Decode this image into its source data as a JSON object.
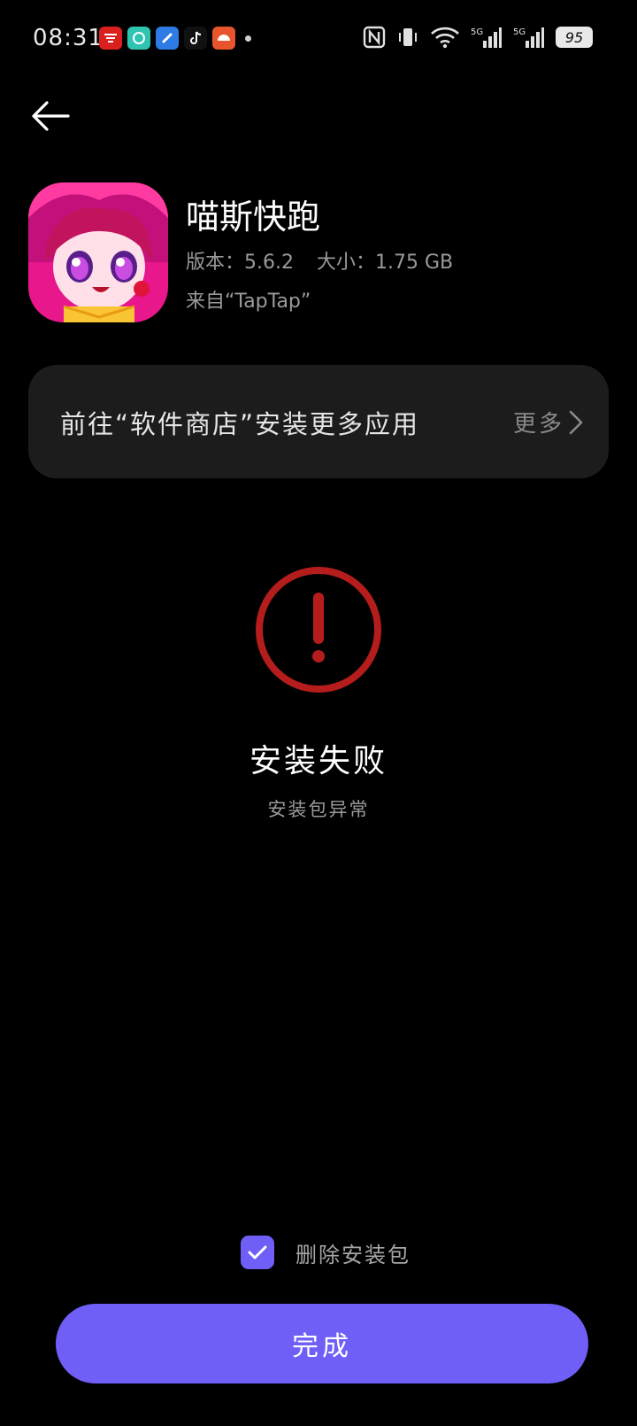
{
  "status_bar": {
    "time": "08:31",
    "notification_icons": [
      {
        "name": "xuexi-app-icon",
        "color": "#d9201e"
      },
      {
        "name": "chat-app-icon",
        "color": "#2fc4b2"
      },
      {
        "name": "notes-app-icon",
        "color": "#2e7be6"
      },
      {
        "name": "tiktok-app-icon",
        "color": "#111111"
      },
      {
        "name": "game-app-icon",
        "color": "#e8542b"
      }
    ],
    "system_icons": [
      "nfc-icon",
      "vibrate-icon",
      "wifi-icon",
      "signal-5g-icon",
      "signal-5g-icon"
    ],
    "signal_label": "5G",
    "battery": "95"
  },
  "app": {
    "name": "喵斯快跑",
    "version_label": "版本：",
    "version": "5.6.2",
    "size_label": "大小：",
    "size": "1.75 GB",
    "source": "来自“TapTap”"
  },
  "store_card": {
    "text": "前往“软件商店”安装更多应用",
    "more": "更多"
  },
  "result": {
    "title": "安装失败",
    "subtitle": "安装包异常",
    "icon": "error-icon",
    "icon_color": "#b51d1d"
  },
  "delete_package": {
    "label": "删除安装包",
    "checked": true
  },
  "done_button": {
    "label": "完成"
  },
  "colors": {
    "accent": "#6f5ff7",
    "background": "#000000",
    "card": "#1c1c1c"
  }
}
